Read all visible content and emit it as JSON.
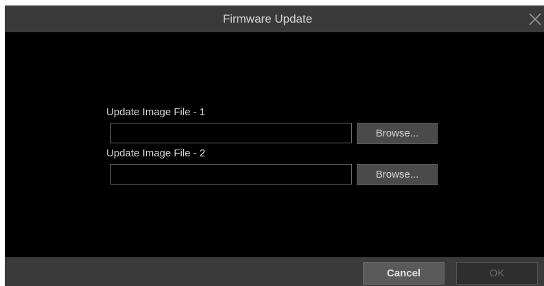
{
  "dialog": {
    "title": "Firmware Update",
    "close_icon": "close-icon"
  },
  "fields": [
    {
      "label": "Update Image File - 1",
      "value": "",
      "browse_label": "Browse..."
    },
    {
      "label": "Update Image File - 2",
      "value": "",
      "browse_label": "Browse..."
    }
  ],
  "footer": {
    "cancel_label": "Cancel",
    "ok_label": "OK",
    "ok_disabled": true
  },
  "colors": {
    "background": "#000000",
    "titlebar": "#3a3a3a",
    "button": "#4a4a4a",
    "text": "#d8d8d8",
    "disabled_text": "#6e6e6e"
  }
}
